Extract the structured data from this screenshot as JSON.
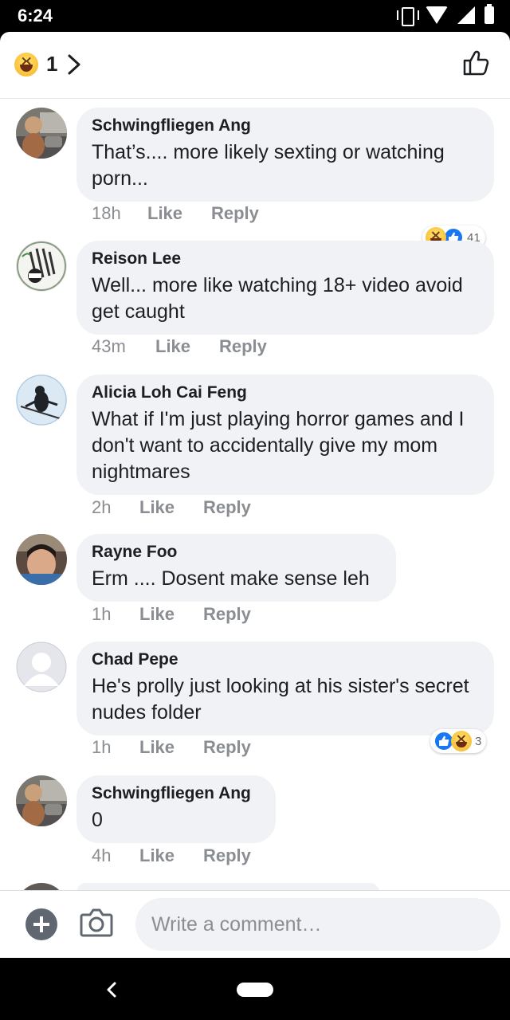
{
  "status_bar": {
    "time": "6:24"
  },
  "header": {
    "reaction_count": "1"
  },
  "comments": [
    {
      "author": "Schwingfliegen Ang",
      "text": "That’s.... more likely sexting or watching porn...",
      "time": "18h",
      "like": "Like",
      "reply": "Reply",
      "reactions": "41"
    },
    {
      "author": "Reison Lee",
      "text": "Well... more like watching 18+ video avoid get caught",
      "time": "43m",
      "like": "Like",
      "reply": "Reply"
    },
    {
      "author": "Alicia Loh Cai Feng",
      "text": "What if I'm just playing horror games and I don't want to accidentally give my mom nightmares",
      "time": "2h",
      "like": "Like",
      "reply": "Reply"
    },
    {
      "author": "Rayne Foo",
      "text": "Erm .... Dosent make sense leh",
      "time": "1h",
      "like": "Like",
      "reply": "Reply"
    },
    {
      "author": "Chad Pepe",
      "text": "He's prolly just looking at his sister's secret nudes folder",
      "time": "1h",
      "like": "Like",
      "reply": "Reply",
      "reactions": "3"
    },
    {
      "author": "Schwingfliegen Ang",
      "text": "0",
      "time": "4h",
      "like": "Like",
      "reply": "Reply"
    }
  ],
  "composer": {
    "placeholder": "Write a comment…"
  },
  "colors": {
    "accent": "#1877f2",
    "bubble": "#f0f2f5",
    "meta": "#8a8d91"
  }
}
